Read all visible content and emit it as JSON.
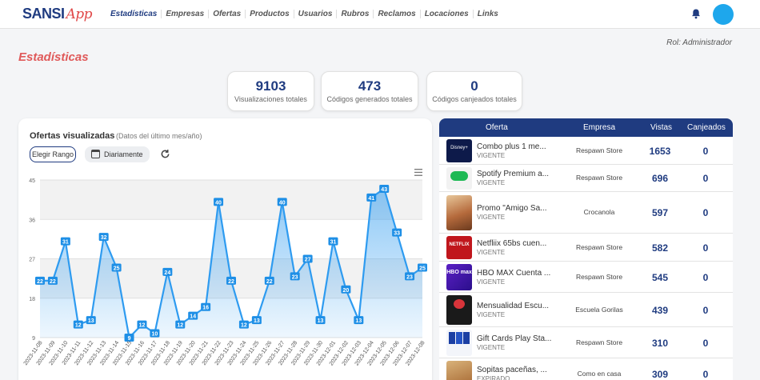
{
  "brand": {
    "sansi": "SANSI",
    "app": "App"
  },
  "nav": [
    "Estadísticas",
    "Empresas",
    "Ofertas",
    "Productos",
    "Usuarios",
    "Rubros",
    "Reclamos",
    "Locaciones",
    "Links"
  ],
  "role": "Rol: Administrador",
  "page_title": "Estadísticas",
  "stats": [
    {
      "value": "9103",
      "label": "Visualizaciones totales"
    },
    {
      "value": "473",
      "label": "Códigos generados totales"
    },
    {
      "value": "0",
      "label": "Códigos canjeados totales"
    }
  ],
  "chart_panel": {
    "title": "Ofertas visualizadas",
    "subtitle": "(Datos del último mes/año)",
    "range_button": "Elegir Rango",
    "daily_button": "Diariamente"
  },
  "chart_data": {
    "type": "area",
    "x": [
      "2023-11-08",
      "2023-11-09",
      "2023-11-10",
      "2023-11-11",
      "2023-11-12",
      "2023-11-13",
      "2023-11-14",
      "2023-11-15",
      "2023-11-16",
      "2023-11-17",
      "2023-11-18",
      "2023-11-19",
      "2023-11-20",
      "2023-11-21",
      "2023-11-22",
      "2023-11-23",
      "2023-11-24",
      "2023-11-25",
      "2023-11-26",
      "2023-11-27",
      "2023-11-28",
      "2023-11-29",
      "2023-11-30",
      "2023-12-01",
      "2023-12-02",
      "2023-12-03",
      "2023-12-04",
      "2023-12-05",
      "2023-12-06",
      "2023-12-07",
      "2023-12-08"
    ],
    "values": [
      22,
      22,
      31,
      12,
      13,
      32,
      25,
      9,
      12,
      10,
      24,
      12,
      14,
      16,
      40,
      22,
      12,
      13,
      22,
      40,
      23,
      27,
      13,
      31,
      20,
      13,
      41,
      43,
      33,
      23,
      25
    ],
    "y_ticks": [
      9,
      18,
      27,
      36,
      45
    ],
    "ylim": [
      9,
      45
    ],
    "line_color": "#2e9bf0"
  },
  "table": {
    "headers": [
      "Oferta",
      "Empresa",
      "Vistas",
      "Canjeados"
    ],
    "rows": [
      {
        "name": "Combo plus 1 me...",
        "status": "VIGENTE",
        "company": "Respawn Store",
        "views": "1653",
        "canjeados": "0",
        "thumb": "disney-plus-thumbnail"
      },
      {
        "name": "Spotify Premium a...",
        "status": "VIGENTE",
        "company": "Respawn Store",
        "views": "696",
        "canjeados": "0",
        "thumb": "spotify-thumbnail"
      },
      {
        "name": "Promo \"Amigo Sa...",
        "status": "VIGENTE",
        "company": "Crocanola",
        "views": "597",
        "canjeados": "0",
        "thumb": "promo-food-thumbnail"
      },
      {
        "name": "Netfliix 65bs cuen...",
        "status": "VIGENTE",
        "company": "Respawn Store",
        "views": "582",
        "canjeados": "0",
        "thumb": "netflix-thumbnail"
      },
      {
        "name": "HBO MAX Cuenta ...",
        "status": "VIGENTE",
        "company": "Respawn Store",
        "views": "545",
        "canjeados": "0",
        "thumb": "hbo-max-thumbnail"
      },
      {
        "name": "Mensualidad Escu...",
        "status": "VIGENTE",
        "company": "Escuela Gorilas",
        "views": "439",
        "canjeados": "0",
        "thumb": "gym-thumbnail"
      },
      {
        "name": "Gift Cards Play Sta...",
        "status": "VIGENTE",
        "company": "Respawn Store",
        "views": "310",
        "canjeados": "0",
        "thumb": "playstation-cards-thumbnail"
      },
      {
        "name": "Sopitas paceñas, ...",
        "status": "EXPIRADO",
        "company": "Como en casa",
        "views": "309",
        "canjeados": "0",
        "thumb": "soup-thumbnail"
      }
    ]
  },
  "thumb_texts": {
    "disney": "Disney+",
    "netflix": "NETFLIX",
    "hbo": "HBO max"
  },
  "icons": [
    "bell-icon",
    "calendar-icon",
    "refresh-icon",
    "hamburger-menu-icon"
  ]
}
